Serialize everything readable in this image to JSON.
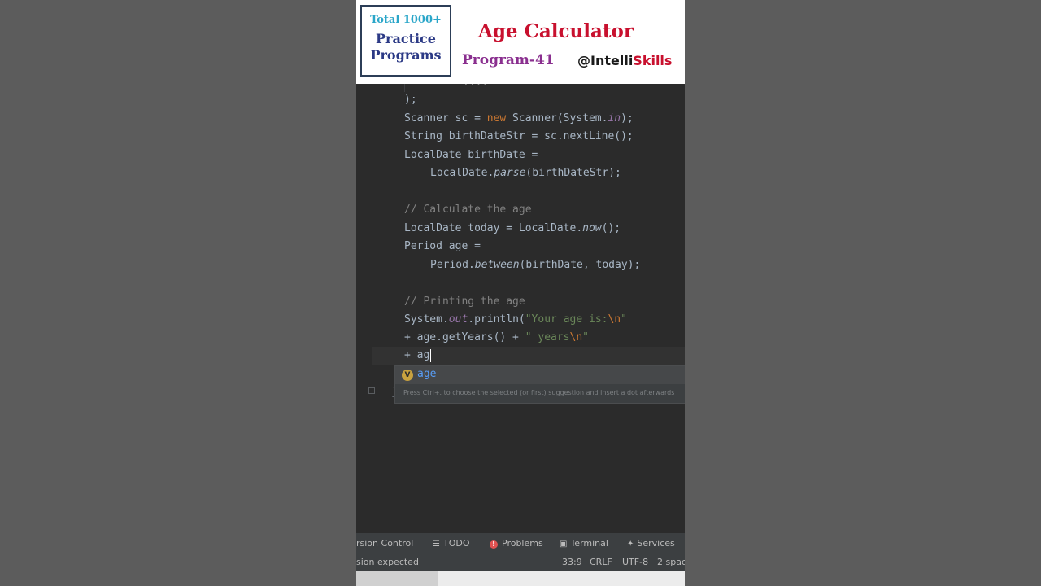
{
  "banner": {
    "badge_line1": "Total 1000+",
    "badge_line2": "Practice",
    "badge_line3": "Programs",
    "title": "Age Calculator",
    "program": "Program-41",
    "handle_prefix": "@Intelli",
    "handle_suffix": "Skills"
  },
  "editor": {
    "lines": [
      {
        "id": "l0",
        "text": "...."
      },
      {
        "id": "l1",
        "text": ");"
      },
      {
        "id": "l2a",
        "text": "Scanner sc = "
      },
      {
        "id": "l2b",
        "text": "new"
      },
      {
        "id": "l2c",
        "text": " Scanner(System."
      },
      {
        "id": "l2d",
        "text": "in"
      },
      {
        "id": "l2e",
        "text": ");"
      },
      {
        "id": "l3",
        "text": "String birthDateStr = sc.nextLine();"
      },
      {
        "id": "l4",
        "text": "LocalDate birthDate ="
      },
      {
        "id": "l5a",
        "text": "LocalDate."
      },
      {
        "id": "l5b",
        "text": "parse"
      },
      {
        "id": "l5c",
        "text": "(birthDateStr);"
      },
      {
        "id": "l6",
        "text": "// Calculate the age"
      },
      {
        "id": "l7a",
        "text": "LocalDate today = LocalDate."
      },
      {
        "id": "l7b",
        "text": "now"
      },
      {
        "id": "l7c",
        "text": "();"
      },
      {
        "id": "l8",
        "text": "Period age ="
      },
      {
        "id": "l9a",
        "text": "Period."
      },
      {
        "id": "l9b",
        "text": "between"
      },
      {
        "id": "l9c",
        "text": "(birthDate, today);"
      },
      {
        "id": "l10",
        "text": "// Printing the age"
      },
      {
        "id": "l11a",
        "text": "System."
      },
      {
        "id": "l11b",
        "text": "out"
      },
      {
        "id": "l11c",
        "text": ".println("
      },
      {
        "id": "l11d",
        "text": "\"Your age is:"
      },
      {
        "id": "l11e",
        "text": "\\n"
      },
      {
        "id": "l11f",
        "text": "\""
      },
      {
        "id": "l12a",
        "text": "+ age.getYears() + "
      },
      {
        "id": "l12b",
        "text": "\" years"
      },
      {
        "id": "l12c",
        "text": "\\n"
      },
      {
        "id": "l12d",
        "text": "\""
      },
      {
        "id": "l13",
        "text": "+ ag"
      },
      {
        "id": "l14",
        "text": "}"
      }
    ],
    "completion": {
      "item_icon": "V",
      "item_label": "age",
      "hint": "Press Ctrl+. to choose the selected (or first) suggestion and insert a dot afterwards"
    }
  },
  "toolbar": {
    "version_control": "rsion Control",
    "todo": "TODO",
    "problems": "Problems",
    "terminal": "Terminal",
    "services": "Services"
  },
  "status": {
    "message": "sion expected",
    "position": "33:9",
    "line_sep": "CRLF",
    "encoding": "UTF-8",
    "indent": "2 spac"
  }
}
